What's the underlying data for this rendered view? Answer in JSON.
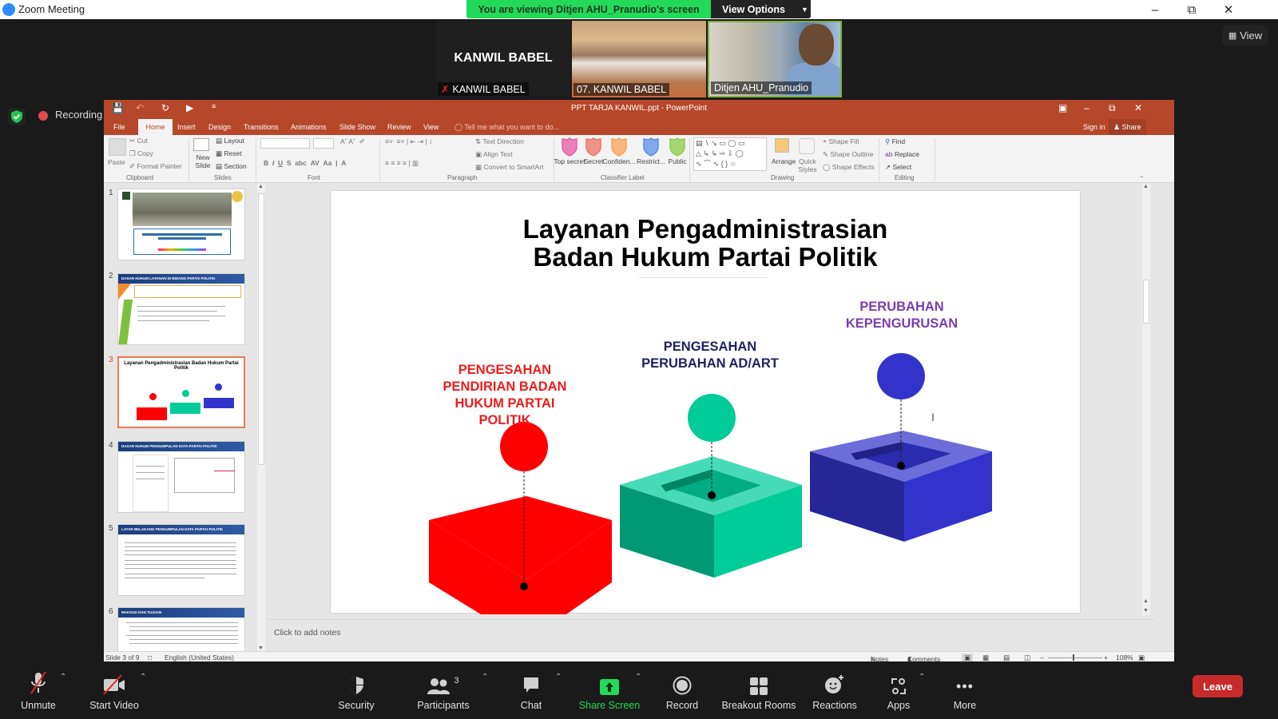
{
  "zoom": {
    "window_title": "Zoom Meeting",
    "banner": "You are viewing Ditjen AHU_Pranudio's screen",
    "view_options": "View Options",
    "view_button": "View",
    "recording_label": "Recording",
    "participants_tiles": [
      {
        "big_name": "KANWIL BABEL",
        "name": "KANWIL BABEL",
        "muted": true
      },
      {
        "name": "07. KANWIL BABEL",
        "muted": false
      },
      {
        "name": "Ditjen AHU_Pranudio",
        "muted": false,
        "active_speaker": true
      }
    ],
    "toolbar": {
      "unmute": "Unmute",
      "start_video": "Start Video",
      "security": "Security",
      "participants": "Participants",
      "participants_count": "3",
      "chat": "Chat",
      "share_screen": "Share Screen",
      "record": "Record",
      "breakout_rooms": "Breakout Rooms",
      "reactions": "Reactions",
      "apps": "Apps",
      "more": "More",
      "leave": "Leave"
    }
  },
  "powerpoint": {
    "title": "PPT TARJA KANWIL.ppt - PowerPoint",
    "sign_in": "Sign in",
    "share": "Share",
    "tabs": [
      "File",
      "Home",
      "Insert",
      "Design",
      "Transitions",
      "Animations",
      "Slide Show",
      "Review",
      "View"
    ],
    "active_tab": "Home",
    "tell_me": "Tell me what you want to do...",
    "ribbon": {
      "clipboard": {
        "label": "Clipboard",
        "paste": "Paste",
        "cut": "Cut",
        "copy": "Copy",
        "format_painter": "Format Painter"
      },
      "slides": {
        "label": "Slides",
        "new_slide": "New Slide",
        "layout": "Layout",
        "reset": "Reset",
        "section": "Section"
      },
      "font": {
        "label": "Font"
      },
      "paragraph": {
        "label": "Paragraph",
        "text_direction": "Text Direction",
        "align_text": "Align Text",
        "convert_smartart": "Convert to SmartArt"
      },
      "classifier": {
        "label": "Classifier Label",
        "items": [
          {
            "label": "Top secret",
            "color": "#e85aa6"
          },
          {
            "label": "Secret",
            "color": "#f0716b"
          },
          {
            "label": "Confiden...",
            "color": "#f7a25a"
          },
          {
            "label": "Restrict...",
            "color": "#5a8fe8"
          },
          {
            "label": "Public",
            "color": "#8ccc4a"
          }
        ]
      },
      "drawing": {
        "label": "Drawing",
        "arrange": "Arrange",
        "quick_styles": "Quick Styles",
        "shape_fill": "Shape Fill",
        "shape_outline": "Shape Outline",
        "shape_effects": "Shape Effects"
      },
      "editing": {
        "label": "Editing",
        "find": "Find",
        "replace": "Replace",
        "select": "Select"
      }
    },
    "thumbnails": [
      {
        "num": "1",
        "title": "PENGUMPULAN DATA ALAMAT KANTOR DAN KEPENGURUSAN PARTAI POLITIK TINGKAT PROVINSI"
      },
      {
        "num": "2",
        "title": "DASAR HUKUM LAYANAN DI BIDANG PARTAI POLITIK"
      },
      {
        "num": "3",
        "title": "Layanan Pengadministrasian Badan Hukum Partai Politik",
        "selected": true
      },
      {
        "num": "4",
        "title": "DASAR HUKUM PENGUMPULAN DATA PARTAI POLITIK"
      },
      {
        "num": "5",
        "title": "LATAR BELAKANG PENGUMPULAN DATA PARTAI POLITIK"
      },
      {
        "num": "6",
        "title": "MAKSUD DAN TUJUAN"
      }
    ],
    "slide": {
      "title_line1": "Layanan Pengadministrasian",
      "title_line2": "Badan Hukum Partai Politik",
      "items": [
        {
          "label": "PENGESAHAN PENDIRIAN BADAN HUKUM PARTAI POLITIK",
          "lines": [
            "PENGESAHAN",
            "PENDIRIAN BADAN",
            "HUKUM PARTAI",
            "POLITIK"
          ],
          "text_color": "#ee1c1c",
          "fill": "#ff0000"
        },
        {
          "label": "PENGESAHAN PERUBAHAN AD/ART",
          "lines": [
            "PENGESAHAN",
            "PERUBAHAN AD/ART"
          ],
          "text_color": "#1f2160",
          "fill": "#00cc99"
        },
        {
          "label": "PERUBAHAN KEPENGURUSAN",
          "lines": [
            "PERUBAHAN",
            "KEPENGURUSAN"
          ],
          "text_color": "#7a3db0",
          "fill": "#3333cc"
        }
      ]
    },
    "notes_placeholder": "Click to add notes",
    "status": {
      "slide_of": "Slide 3 of 9",
      "language": "English (United States)",
      "notes": "Notes",
      "comments": "Comments",
      "zoom_level": "108%"
    }
  }
}
